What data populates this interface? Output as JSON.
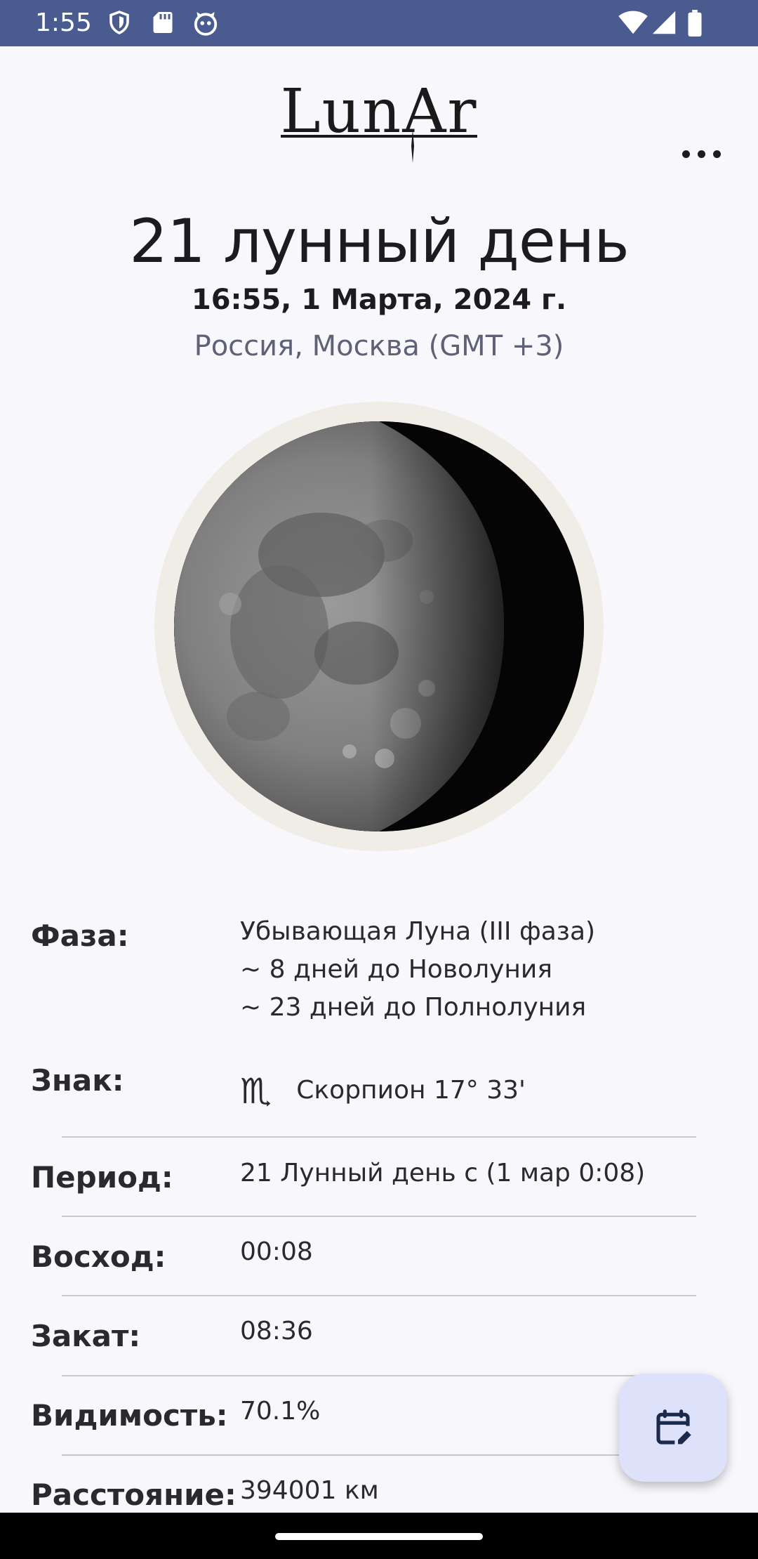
{
  "status_bar": {
    "time": "1:55"
  },
  "app": {
    "logo": "LunAr"
  },
  "header": {
    "title": "21 лунный день",
    "datetime": "16:55, 1 Марта, 2024 г.",
    "location": "Россия, Москва (GMT +3)"
  },
  "details": {
    "phase": {
      "label": "Фаза:",
      "lines": [
        "Убывающая Луна (III фаза)",
        "~ 8 дней до Новолуния",
        "~ 23 дней до Полнолуния"
      ]
    },
    "sign": {
      "label": "Знак:",
      "symbol": "♏",
      "value": "Скорпион 17° 33'"
    },
    "period": {
      "label": "Период:",
      "value": "21 Лунный день с (1 мар 0:08)"
    },
    "rise": {
      "label": "Восход:",
      "value": "00:08"
    },
    "set": {
      "label": "Закат:",
      "value": "08:36"
    },
    "visibility": {
      "label": "Видимость:",
      "value": "70.1%"
    },
    "distance": {
      "label": "Расстояние:",
      "value": "394001 км"
    }
  },
  "colors": {
    "status_bar": "#4a5b90",
    "background": "#f8f7fc",
    "fab": "#dde2fa"
  }
}
